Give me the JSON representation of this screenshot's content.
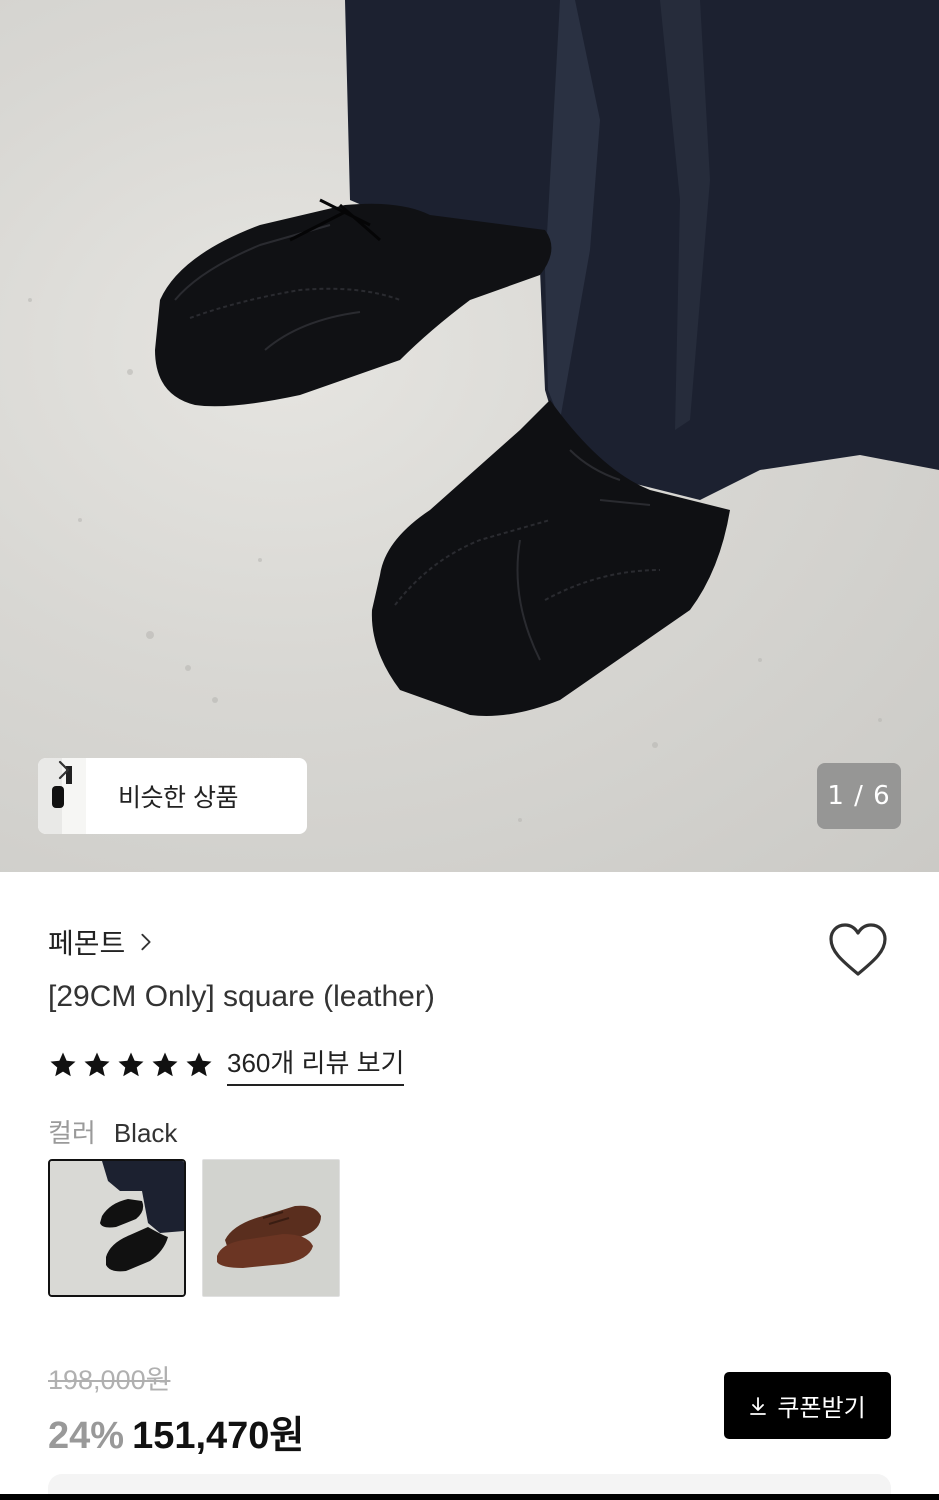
{
  "hero": {
    "image_alt": "product-photo-black-leather-square-toe-shoes",
    "similar_label": "비슷한 상품",
    "counter": "1 / 6"
  },
  "product": {
    "brand": "페몬트",
    "title": "[29CM Only] square (leather)",
    "rating_stars": 5,
    "review_link": "360개 리뷰 보기",
    "color_label": "컬러",
    "color_value": "Black",
    "swatches": [
      "Black",
      "Brown"
    ],
    "original_price": "198,000원",
    "discount": "24%",
    "price": "151,470원",
    "coupon_label": "쿠폰받기"
  },
  "icons": {
    "heart": "heart-outline-icon",
    "chevron": "chevron-right-icon",
    "star": "star-icon",
    "download": "download-icon"
  },
  "colors": {
    "primary": "#000000",
    "text": "#222222",
    "muted": "#9a9a9a",
    "strike": "#b0b0b0"
  }
}
